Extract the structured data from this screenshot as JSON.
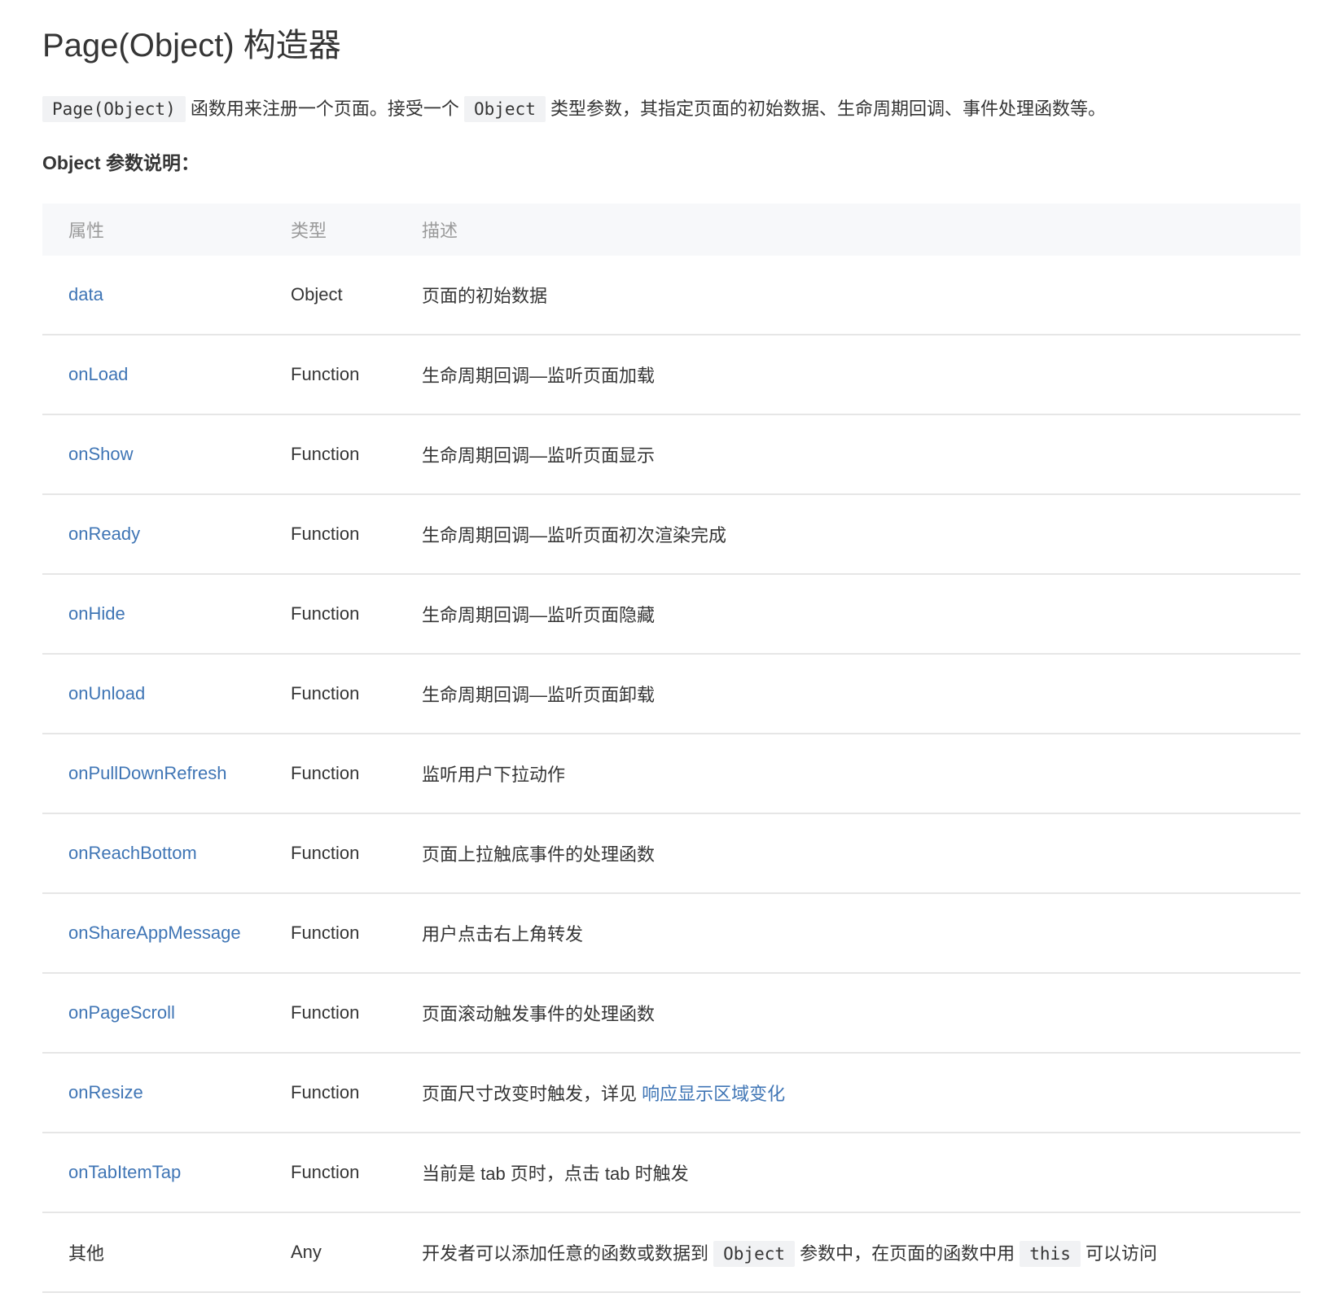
{
  "title": "Page(Object) 构造器",
  "intro": {
    "code1": "Page(Object)",
    "text1": "函数用来注册一个页面。接受一个",
    "code2": "Object",
    "text2": "类型参数，其指定页面的初始数据、生命周期回调、事件处理函数等。"
  },
  "section_title": "Object 参数说明：",
  "table": {
    "headers": [
      "属性",
      "类型",
      "描述"
    ],
    "rows": [
      {
        "prop": "data",
        "type": "Object",
        "desc": "页面的初始数据"
      },
      {
        "prop": "onLoad",
        "type": "Function",
        "desc": "生命周期回调—监听页面加载"
      },
      {
        "prop": "onShow",
        "type": "Function",
        "desc": "生命周期回调—监听页面显示"
      },
      {
        "prop": "onReady",
        "type": "Function",
        "desc": "生命周期回调—监听页面初次渲染完成"
      },
      {
        "prop": "onHide",
        "type": "Function",
        "desc": "生命周期回调—监听页面隐藏"
      },
      {
        "prop": "onUnload",
        "type": "Function",
        "desc": "生命周期回调—监听页面卸载"
      },
      {
        "prop": "onPullDownRefresh",
        "type": "Function",
        "desc": "监听用户下拉动作"
      },
      {
        "prop": "onReachBottom",
        "type": "Function",
        "desc": "页面上拉触底事件的处理函数"
      },
      {
        "prop": "onShareAppMessage",
        "type": "Function",
        "desc": "用户点击右上角转发"
      },
      {
        "prop": "onPageScroll",
        "type": "Function",
        "desc": "页面滚动触发事件的处理函数"
      },
      {
        "prop": "onResize",
        "type": "Function",
        "desc": "页面尺寸改变时触发，详见",
        "desc_link": "响应显示区域变化"
      },
      {
        "prop": "onTabItemTap",
        "type": "Function",
        "desc": "当前是 tab 页时，点击 tab 时触发"
      }
    ],
    "last_row": {
      "prop": "其他",
      "type": "Any",
      "desc1": "开发者可以添加任意的函数或数据到",
      "code1": "Object",
      "desc2": "参数中，在页面的函数中用",
      "code2": "this",
      "desc3": "可以访问"
    }
  },
  "colors": {
    "link": "#3f75b5",
    "text": "#353535",
    "header_text": "#9a9a9a",
    "header_bg": "#f7f8fa",
    "code_bg": "#f1f2f4",
    "border": "#e6e6e6"
  }
}
